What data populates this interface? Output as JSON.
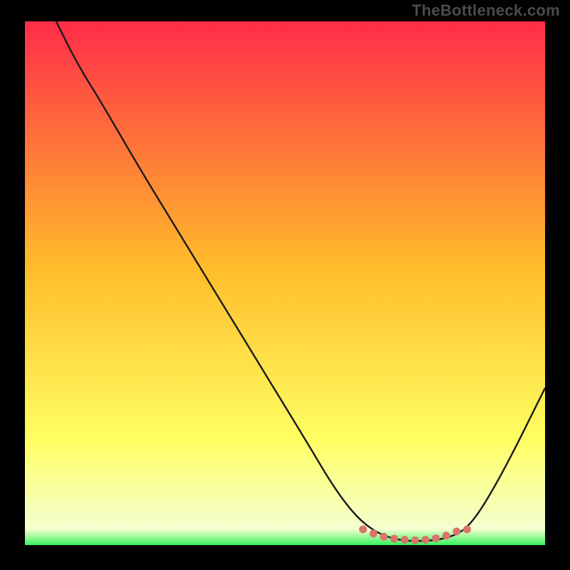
{
  "watermark": "TheBottleneck.com",
  "colors": {
    "bg": "#000000",
    "grad_top": "#ff2c49",
    "grad_mid": "#ffbc2a",
    "grad_low": "#ffff63",
    "grad_base": "#37f35d",
    "stroke": "#1a1a1a",
    "marker": "#d9756a"
  },
  "chart_data": {
    "type": "line",
    "title": "",
    "xlabel": "",
    "ylabel": "",
    "xlim": [
      0,
      100
    ],
    "ylim": [
      0,
      100
    ],
    "curve": [
      {
        "x": 6,
        "y": 100
      },
      {
        "x": 10,
        "y": 92
      },
      {
        "x": 15,
        "y": 84
      },
      {
        "x": 22,
        "y": 72
      },
      {
        "x": 30,
        "y": 59
      },
      {
        "x": 38,
        "y": 46
      },
      {
        "x": 46,
        "y": 33
      },
      {
        "x": 54,
        "y": 20
      },
      {
        "x": 60,
        "y": 10
      },
      {
        "x": 65,
        "y": 4
      },
      {
        "x": 70,
        "y": 1.2
      },
      {
        "x": 76,
        "y": 0.6
      },
      {
        "x": 82,
        "y": 1.4
      },
      {
        "x": 86,
        "y": 4
      },
      {
        "x": 92,
        "y": 14
      },
      {
        "x": 100,
        "y": 30
      }
    ],
    "flat_markers": [
      {
        "x": 65,
        "y": 3.0
      },
      {
        "x": 67,
        "y": 2.2
      },
      {
        "x": 69,
        "y": 1.6
      },
      {
        "x": 71,
        "y": 1.2
      },
      {
        "x": 73,
        "y": 1.0
      },
      {
        "x": 75,
        "y": 0.9
      },
      {
        "x": 77,
        "y": 1.0
      },
      {
        "x": 79,
        "y": 1.3
      },
      {
        "x": 81,
        "y": 1.8
      },
      {
        "x": 83,
        "y": 2.6
      },
      {
        "x": 85,
        "y": 3.0
      }
    ]
  }
}
